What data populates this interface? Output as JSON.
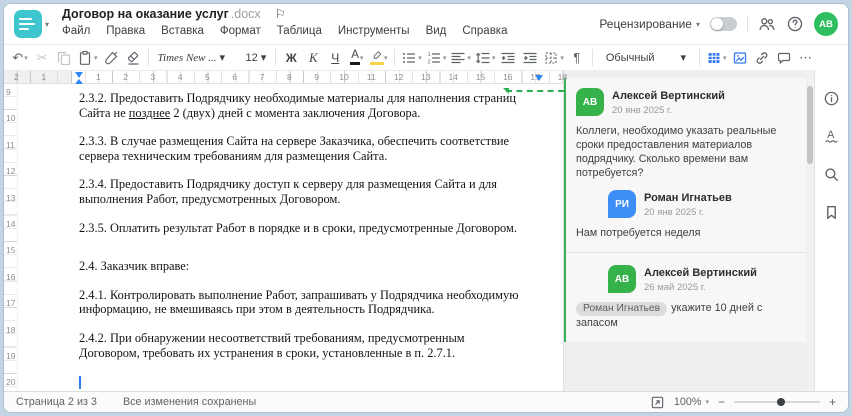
{
  "window": {
    "title": "Договор на оказание услуг",
    "title_ext": ".docx"
  },
  "menu": {
    "items": [
      "Файл",
      "Правка",
      "Вставка",
      "Формат",
      "Таблица",
      "Инструменты",
      "Вид",
      "Справка"
    ]
  },
  "header": {
    "review_label": "Рецензирование",
    "avatar_initials": "АВ"
  },
  "toolbar": {
    "font_name": "Times New ...",
    "font_size": "12",
    "bold_label": "Ж",
    "italic_label": "К",
    "underline_label": "Ч",
    "font_color_label": "А",
    "highlight_label": "А",
    "style_name": "Обычный"
  },
  "icons": {
    "flag": "⚐",
    "undo": "↶",
    "caret": "▾",
    "cut": "✂",
    "paragraph_mark": "¶",
    "more": "⋯",
    "minus": "−",
    "plus": "+"
  },
  "ruler": {
    "h_numbers": [
      {
        "label": "2",
        "cm": -2
      },
      {
        "label": "1",
        "cm": -1
      },
      {
        "label": "1",
        "cm": 1
      },
      {
        "label": "2",
        "cm": 2
      },
      {
        "label": "3",
        "cm": 3
      },
      {
        "label": "4",
        "cm": 4
      },
      {
        "label": "5",
        "cm": 5
      },
      {
        "label": "6",
        "cm": 6
      },
      {
        "label": "7",
        "cm": 7
      },
      {
        "label": "8",
        "cm": 8
      },
      {
        "label": "9",
        "cm": 9
      },
      {
        "label": "10",
        "cm": 10
      },
      {
        "label": "11",
        "cm": 11
      },
      {
        "label": "12",
        "cm": 12
      },
      {
        "label": "13",
        "cm": 13
      },
      {
        "label": "14",
        "cm": 14
      },
      {
        "label": "15",
        "cm": 15
      },
      {
        "label": "16",
        "cm": 16
      },
      {
        "label": "17",
        "cm": 17
      },
      {
        "label": "18",
        "cm": 18
      }
    ],
    "v_numbers": [
      "9",
      "10",
      "11",
      "12",
      "13",
      "14",
      "15",
      "16",
      "17",
      "18",
      "19",
      "20"
    ]
  },
  "document": {
    "p1_before": "2.3.2. Предоставить Подрядчику необходимые материалы для наполнения страниц Сайта не ",
    "p1_underlined": "позднее",
    "p1_after": " 2 (двух) дней с момента заключения Договора.",
    "paragraphs": [
      "2.3.3. В случае размещения Сайта на сервере Заказчика, обеспечить соответствие сервера техническим требованиям для размещения Сайта.",
      "2.3.4. Предоставить Подрядчику доступ к серверу для размещения Сайта и для выполнения Работ, предусмотренных Договором.",
      "2.3.5. Оплатить результат Работ в порядке и в сроки, предусмотренные Договором.",
      "2.4. Заказчик вправе:",
      "2.4.1. Контролировать выполнение Работ, запрашивать у Подрядчика необходимую информацию, не вмешиваясь при этом в деятельность Подрядчика.",
      "2.4.2. При обнаружении несоответствий требованиям, предусмотренным Договором, требовать их устранения в сроки, установленные в п. 2.7.1."
    ]
  },
  "comments": {
    "thread": [
      {
        "initials": "АВ",
        "name": "Алексей Вертинский",
        "date": "20 янв 2025 г.",
        "text": "Коллеги, необходимо указать реальные сроки предоставления материалов подрядчику. Сколько времени вам потребуется?"
      },
      {
        "initials": "РИ",
        "name": "Роман Игнатьев",
        "date": "20 янв 2025 г.",
        "text": "Нам потребуется неделя"
      },
      {
        "initials": "АВ",
        "name": "Алексей Вертинский",
        "date": "26 май 2025 г.",
        "mention": "Роман Игнатьев",
        "text": "укажите 10 дней с запасом"
      }
    ]
  },
  "statusbar": {
    "page_label": "Страница 2 из 3",
    "saved_label": "Все изменения сохранены",
    "zoom_value": "100%"
  },
  "colors": {
    "accent_teal": "#3ec6cf",
    "comment_green": "#34b357",
    "avatar_green": "#36b24a",
    "avatar_blue": "#3e8ef7",
    "toolbar_blue": "#3579f2",
    "highlight_yellow": "#f7d54a",
    "indent_marker_blue": "#2f86f5"
  }
}
